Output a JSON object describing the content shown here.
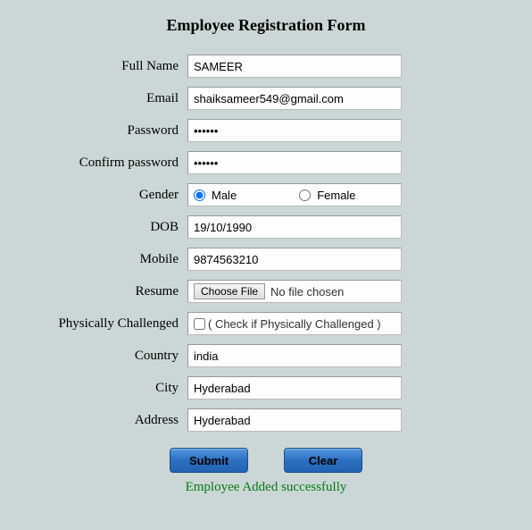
{
  "title": "Employee Registration Form",
  "labels": {
    "fullName": "Full Name",
    "email": "Email",
    "password": "Password",
    "confirmPassword": "Confirm password",
    "gender": "Gender",
    "dob": "DOB",
    "mobile": "Mobile",
    "resume": "Resume",
    "physicallyChallenged": "Physically Challenged",
    "country": "Country",
    "city": "City",
    "address": "Address"
  },
  "values": {
    "fullName": "SAMEER",
    "email": "shaiksameer549@gmail.com",
    "password": "••••••",
    "confirmPassword": "••••••",
    "dob": "19/10/1990",
    "mobile": "9874563210",
    "country": "india",
    "city": "Hyderabad",
    "address": "Hyderabad"
  },
  "gender": {
    "male": "Male",
    "female": "Female"
  },
  "file": {
    "button": "Choose File",
    "status": "No file chosen"
  },
  "physicallyChallengedText": "( Check if Physically Challenged )",
  "buttons": {
    "submit": "Submit",
    "clear": "Clear"
  },
  "statusMessage": "Employee Added successfully"
}
